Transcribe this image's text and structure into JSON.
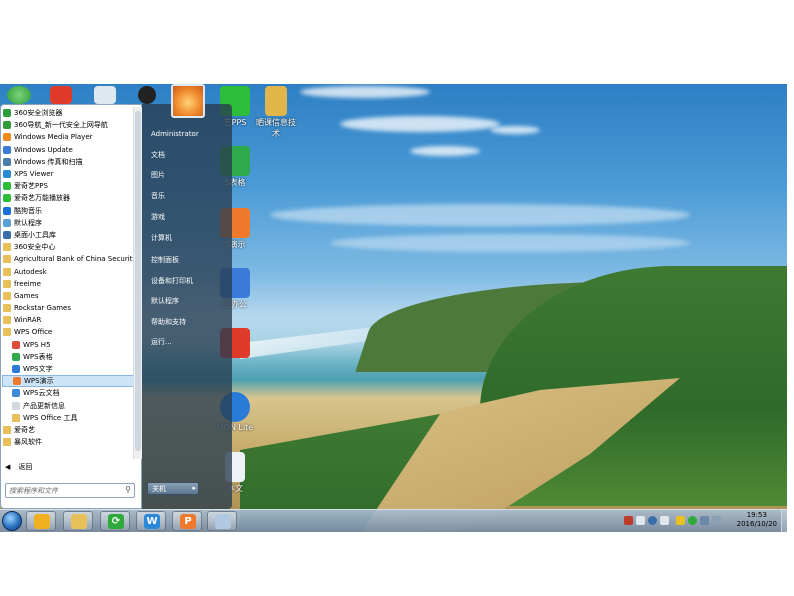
{
  "desktop": {
    "icons": [
      {
        "name": "browser-360-icon",
        "label": ""
      },
      {
        "name": "pdf-icon",
        "label": ""
      },
      {
        "name": "wps-document-icon",
        "label": ""
      },
      {
        "name": "qq-icon",
        "label": ""
      },
      {
        "name": "iqiyi-pps-icon",
        "label": "艺PPS"
      },
      {
        "name": "folder-icon",
        "label": "晒课信息技术"
      },
      {
        "name": "wps-spreadsheet-icon",
        "label": "S表格"
      },
      {
        "name": "wps-presentation-icon",
        "label": "S演示"
      },
      {
        "name": "network-icon",
        "label": "图办公"
      },
      {
        "name": "acrobat-icon",
        "label": ""
      },
      {
        "name": "daemon-tools-icon",
        "label": "MON Lite"
      },
      {
        "name": "text-file-icon",
        "label": "本文"
      }
    ]
  },
  "start_menu": {
    "programs": [
      {
        "label": "360安全浏览器",
        "sub": false,
        "color": "#2e9d3a"
      },
      {
        "label": "360导航_新一代安全上网导航",
        "sub": false,
        "color": "#2e9d3a"
      },
      {
        "label": "Windows Media Player",
        "sub": false,
        "color": "#f08a1c"
      },
      {
        "label": "Windows Update",
        "sub": false,
        "color": "#3a7bd5"
      },
      {
        "label": "Windows 传真和扫描",
        "sub": false,
        "color": "#4a7da8"
      },
      {
        "label": "XPS Viewer",
        "sub": false,
        "color": "#2a8bd0"
      },
      {
        "label": "爱奇艺PPS",
        "sub": false,
        "color": "#2ebd3a"
      },
      {
        "label": "爱奇艺万能播放器",
        "sub": false,
        "color": "#2ebd3a"
      },
      {
        "label": "酷狗音乐",
        "sub": false,
        "color": "#1a6fd8"
      },
      {
        "label": "默认程序",
        "sub": false,
        "color": "#5aa0d8"
      },
      {
        "label": "桌面小工具库",
        "sub": false,
        "color": "#3a6ea8"
      },
      {
        "label": "360安全中心",
        "sub": false,
        "folder": true
      },
      {
        "label": "Agricultural Bank of China Security S",
        "sub": false,
        "folder": true
      },
      {
        "label": "Autodesk",
        "sub": false,
        "folder": true
      },
      {
        "label": "freeime",
        "sub": false,
        "folder": true
      },
      {
        "label": "Games",
        "sub": false,
        "folder": true
      },
      {
        "label": "Rockstar Games",
        "sub": false,
        "folder": true
      },
      {
        "label": "WinRAR",
        "sub": false,
        "folder": true
      },
      {
        "label": "WPS Office",
        "sub": false,
        "folder": true
      },
      {
        "label": "WPS H5",
        "sub": true,
        "color": "#e04a3a"
      },
      {
        "label": "WPS表格",
        "sub": true,
        "color": "#2eaa4a"
      },
      {
        "label": "WPS文字",
        "sub": true,
        "color": "#2a7ad8"
      },
      {
        "label": "WPS演示",
        "sub": true,
        "color": "#f07a2c",
        "selected": true
      },
      {
        "label": "WPS云文档",
        "sub": true,
        "color": "#3a8ad8"
      },
      {
        "label": "产品更新信息",
        "sub": true,
        "color": "#d0d8e0"
      },
      {
        "label": "WPS Office 工具",
        "sub": true,
        "folder": true
      },
      {
        "label": "爱奇艺",
        "sub": false,
        "folder": true
      },
      {
        "label": "暴风软件",
        "sub": false,
        "folder": true
      }
    ],
    "back_label": "返回",
    "search_placeholder": "搜索程序和文件",
    "right_items": [
      "Administrator",
      "文档",
      "图片",
      "音乐",
      "游戏",
      "计算机",
      "控制面板",
      "设备和打印机",
      "默认程序",
      "帮助和支持",
      "运行..."
    ],
    "shutdown_label": "关机"
  },
  "taskbar": {
    "pinned": [
      {
        "name": "taskbar-360-safe-button",
        "glyph": "",
        "color": "#f0b020"
      },
      {
        "name": "taskbar-explorer-button",
        "glyph": "",
        "color": "#e8c05a"
      },
      {
        "name": "taskbar-360-browser-button",
        "glyph": "⟳",
        "color": "#2eaa3a"
      },
      {
        "name": "taskbar-wps-writer-button",
        "glyph": "W",
        "color": "#2a8ad8"
      },
      {
        "name": "taskbar-wps-presentation-button",
        "glyph": "P",
        "color": "#f07a2c"
      },
      {
        "name": "taskbar-paint-button",
        "glyph": "",
        "color": "#b0c8e0"
      }
    ],
    "clock_time": "19:53",
    "clock_date": "2016/10/20"
  }
}
